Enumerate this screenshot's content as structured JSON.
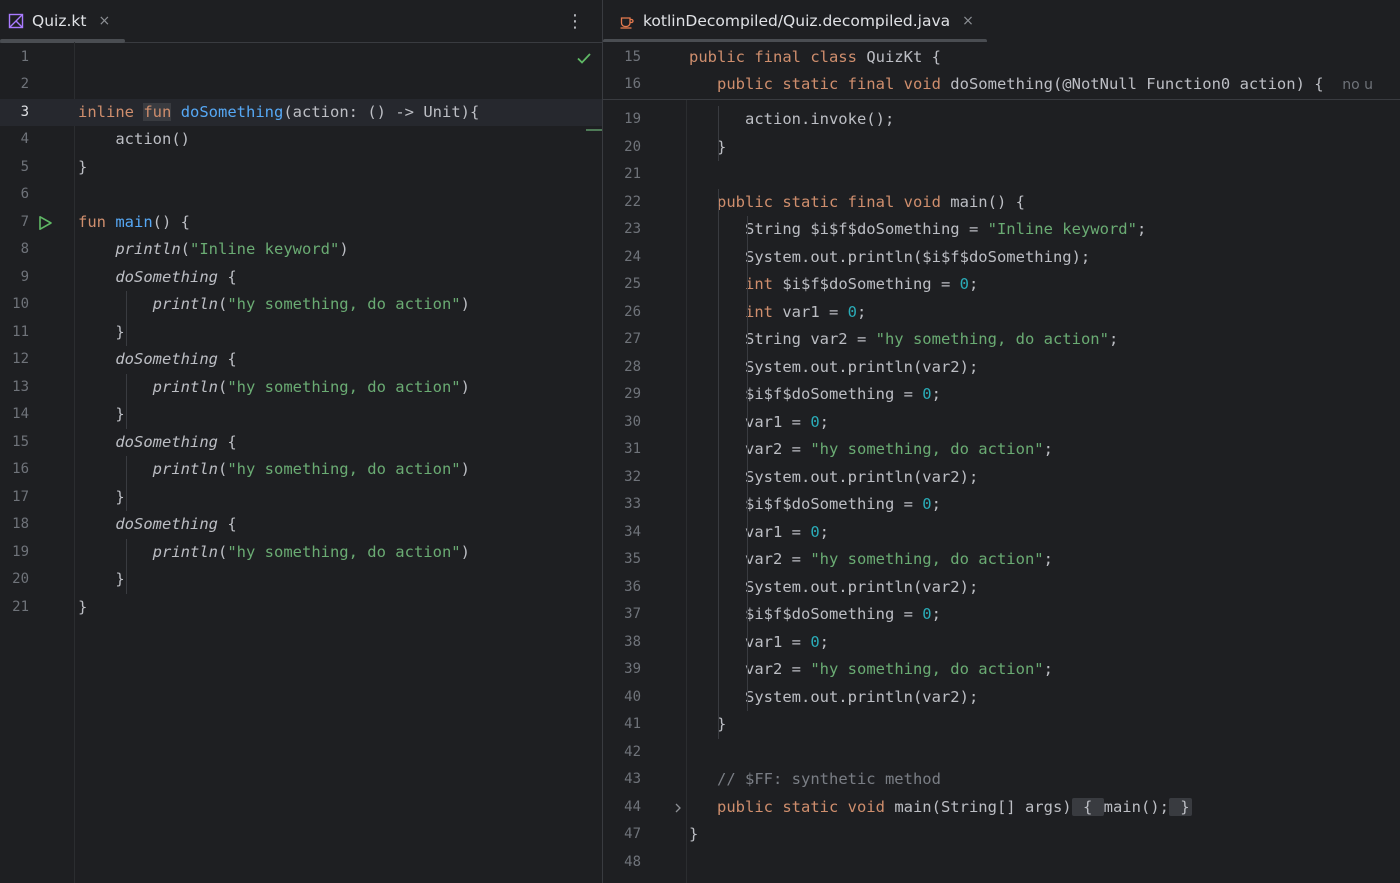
{
  "left": {
    "tab": {
      "title": "Quiz.kt",
      "close": "×"
    },
    "menu_icon": "⋮",
    "lines": [
      {
        "n": "1",
        "html": ""
      },
      {
        "n": "2",
        "html": ""
      },
      {
        "n": "3",
        "html": "<span class=\"kw\">inline</span> <span class=\"kw funhl\">fun</span> <span class=\"fn\">doSomething</span>(action: () -> Unit){"
      },
      {
        "n": "4",
        "html": "    action()"
      },
      {
        "n": "5",
        "html": "}"
      },
      {
        "n": "6",
        "html": ""
      },
      {
        "n": "7",
        "html": "<span class=\"kw\">fun</span> <span class=\"fn\">main</span>() {"
      },
      {
        "n": "8",
        "html": "    <span class=\"it\">println</span>(<span class=\"str\">\"Inline keyword\"</span>)"
      },
      {
        "n": "9",
        "html": "    <span class=\"it\">doSomething</span> {"
      },
      {
        "n": "10",
        "html": "        <span class=\"it\">println</span>(<span class=\"str\">\"hy something, do action\"</span>)"
      },
      {
        "n": "11",
        "html": "    }"
      },
      {
        "n": "12",
        "html": "    <span class=\"it\">doSomething</span> {"
      },
      {
        "n": "13",
        "html": "        <span class=\"it\">println</span>(<span class=\"str\">\"hy something, do action\"</span>)"
      },
      {
        "n": "14",
        "html": "    }"
      },
      {
        "n": "15",
        "html": "    <span class=\"it\">doSomething</span> {"
      },
      {
        "n": "16",
        "html": "        <span class=\"it\">println</span>(<span class=\"str\">\"hy something, do action\"</span>)"
      },
      {
        "n": "17",
        "html": "    }"
      },
      {
        "n": "18",
        "html": "    <span class=\"it\">doSomething</span> {"
      },
      {
        "n": "19",
        "html": "        <span class=\"it\">println</span>(<span class=\"str\">\"hy something, do action\"</span>)"
      },
      {
        "n": "20",
        "html": "    }"
      },
      {
        "n": "21",
        "html": "}"
      }
    ]
  },
  "right": {
    "tab": {
      "title": "kotlinDecompiled/Quiz.decompiled.java",
      "close": "×"
    },
    "sticky": [
      {
        "n": "15",
        "html": "<span class=\"kw\">public final class</span> QuizKt {"
      },
      {
        "n": "16",
        "html": "   <span class=\"kw\">public static final void</span> doSomething(@NotNull Function0 action) {  <span class=\"hint\">no u</span>"
      }
    ],
    "lines": [
      {
        "n": "19",
        "html": "      action.invoke();"
      },
      {
        "n": "20",
        "html": "   }"
      },
      {
        "n": "21",
        "html": ""
      },
      {
        "n": "22",
        "html": "   <span class=\"kw\">public static final void</span> main() {"
      },
      {
        "n": "23",
        "html": "      String $i$f$doSomething = <span class=\"str\">\"Inline keyword\"</span>;"
      },
      {
        "n": "24",
        "html": "      System.out.println($i$f$doSomething);"
      },
      {
        "n": "25",
        "html": "      <span class=\"kw\">int</span> $i$f$doSomething = <span class=\"num\">0</span>;"
      },
      {
        "n": "26",
        "html": "      <span class=\"kw\">int</span> var1 = <span class=\"num\">0</span>;"
      },
      {
        "n": "27",
        "html": "      String var2 = <span class=\"str\">\"hy something, do action\"</span>;"
      },
      {
        "n": "28",
        "html": "      System.out.println(var2);"
      },
      {
        "n": "29",
        "html": "      $i$f$doSomething = <span class=\"num\">0</span>;"
      },
      {
        "n": "30",
        "html": "      var1 = <span class=\"num\">0</span>;"
      },
      {
        "n": "31",
        "html": "      var2 = <span class=\"str\">\"hy something, do action\"</span>;"
      },
      {
        "n": "32",
        "html": "      System.out.println(var2);"
      },
      {
        "n": "33",
        "html": "      $i$f$doSomething = <span class=\"num\">0</span>;"
      },
      {
        "n": "34",
        "html": "      var1 = <span class=\"num\">0</span>;"
      },
      {
        "n": "35",
        "html": "      var2 = <span class=\"str\">\"hy something, do action\"</span>;"
      },
      {
        "n": "36",
        "html": "      System.out.println(var2);"
      },
      {
        "n": "37",
        "html": "      $i$f$doSomething = <span class=\"num\">0</span>;"
      },
      {
        "n": "38",
        "html": "      var1 = <span class=\"num\">0</span>;"
      },
      {
        "n": "39",
        "html": "      var2 = <span class=\"str\">\"hy something, do action\"</span>;"
      },
      {
        "n": "40",
        "html": "      System.out.println(var2);"
      },
      {
        "n": "41",
        "html": "   }"
      },
      {
        "n": "42",
        "html": ""
      },
      {
        "n": "43",
        "html": "   <span class=\"cm\">// $FF: synthetic method</span>"
      },
      {
        "n": "44",
        "html": "   <span class=\"kw\">public static void</span> main(String[] args)<span class=\"fold\"> { </span>main();<span class=\"fold\"> }</span>"
      },
      {
        "n": "47",
        "html": "}"
      },
      {
        "n": "48",
        "html": ""
      }
    ]
  },
  "colors": {
    "background": "#1e1f22",
    "keyword": "#cf8e6d",
    "function": "#56a8f5",
    "string": "#6aab73",
    "number": "#2aacb8",
    "comment": "#7a7e85"
  }
}
